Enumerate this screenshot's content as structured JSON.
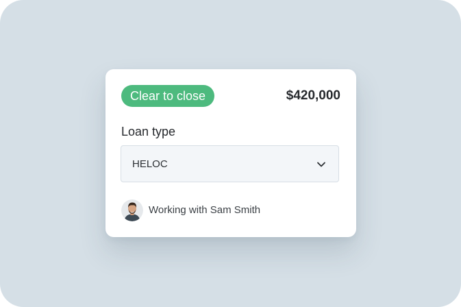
{
  "card": {
    "status_badge": "Clear to close",
    "amount": "$420,000",
    "loan_type_label": "Loan type",
    "loan_type_value": "HELOC",
    "assignee_text": "Working with Sam Smith"
  },
  "icons": {
    "dropdown": "chevron-down-icon",
    "avatar": "avatar"
  },
  "colors": {
    "background": "#d5dfe6",
    "badge": "#4dba7e",
    "select_background": "#f3f6f9"
  }
}
